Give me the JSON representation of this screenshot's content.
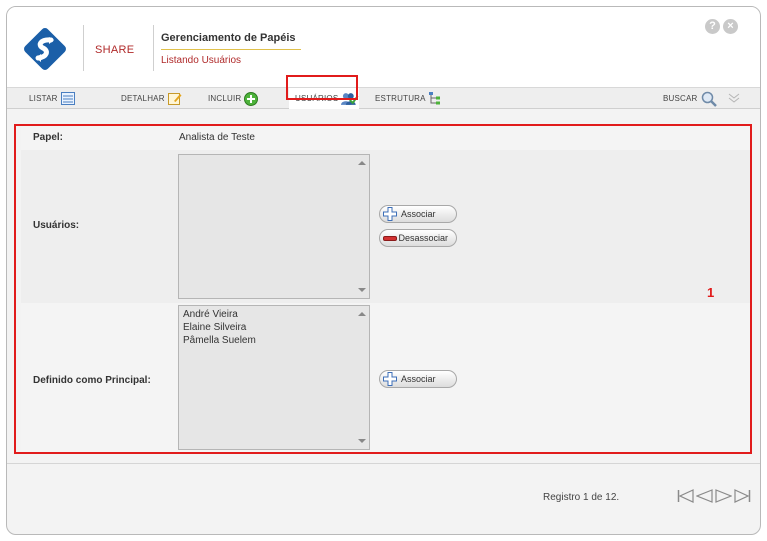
{
  "app": {
    "brand": "SHARE",
    "title": "Gerenciamento de Papéis",
    "subtitle": "Listando Usuários"
  },
  "header_icons": {
    "help": "?",
    "close": "×"
  },
  "toolbar": {
    "listar": "LISTAR",
    "detalhar": "DETALHAR",
    "incluir": "INCLUIR",
    "usuarios": "USUÁRIOS",
    "estrutura": "ESTRUTURA",
    "buscar": "BUSCAR"
  },
  "form": {
    "papel_label": "Papel:",
    "papel_value": "Analista de Teste",
    "usuarios_label": "Usuários:",
    "usuarios_list": [],
    "associar_label": "Associar",
    "desassociar_label": "Desassociar",
    "principal_label": "Definido como Principal:",
    "principal_list": [
      "André Vieira",
      "Elaine Silveira",
      "Pâmella Suelem"
    ],
    "associar2_label": "Associar"
  },
  "annotation": {
    "number": "1"
  },
  "footer": {
    "registro": "Registro 1 de 12."
  },
  "colors": {
    "highlight": "#e11b1b",
    "brand": "#b02a2a",
    "logo_blue": "#1b5fa8"
  },
  "icons": [
    "logo-icon",
    "help-icon",
    "close-icon",
    "list-icon",
    "detail-icon",
    "add-icon",
    "users-icon",
    "tree-icon",
    "search-icon",
    "chevron-down-icon",
    "plus-icon",
    "minus-icon",
    "first-page-icon",
    "prev-page-icon",
    "next-page-icon",
    "last-page-icon"
  ]
}
